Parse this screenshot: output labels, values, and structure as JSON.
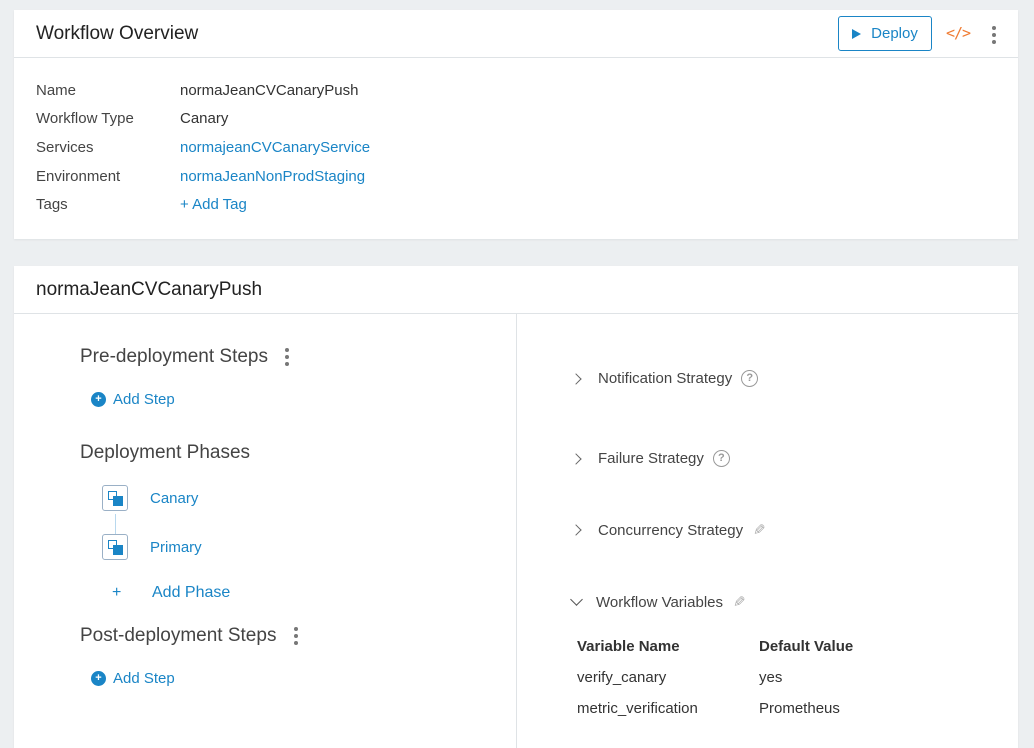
{
  "overview": {
    "title": "Workflow Overview",
    "deploy_label": "Deploy",
    "code_icon_glyph": "</>",
    "fields": [
      {
        "label": "Name",
        "value": "normaJeanCVCanaryPush"
      },
      {
        "label": "Workflow Type",
        "value": "Canary"
      },
      {
        "label": "Services",
        "value": "normajeanCVCanaryService"
      },
      {
        "label": "Environment",
        "value": "normaJeanNonProdStaging"
      },
      {
        "label": "Tags",
        "value": "+ Add Tag"
      }
    ]
  },
  "workflow": {
    "title": "normaJeanCVCanaryPush",
    "pre_deployment": {
      "title": "Pre-deployment Steps",
      "add_step": "Add Step"
    },
    "deployment_phases": {
      "title": "Deployment Phases",
      "phases": [
        "Canary",
        "Primary"
      ],
      "add_phase_plus": "+",
      "add_phase": "Add Phase"
    },
    "post_deployment": {
      "title": "Post-deployment Steps",
      "add_step": "Add Step"
    },
    "strategies": {
      "notification": "Notification Strategy",
      "failure": "Failure Strategy",
      "concurrency": "Concurrency Strategy",
      "variables": "Workflow Variables"
    },
    "variables_table": {
      "headers": [
        "Variable Name",
        "Default Value"
      ],
      "rows": [
        [
          "verify_canary",
          "yes"
        ],
        [
          "metric_verification",
          "Prometheus"
        ]
      ]
    }
  },
  "colors": {
    "accent": "#1a85c6",
    "code_icon": "#f07b32"
  }
}
